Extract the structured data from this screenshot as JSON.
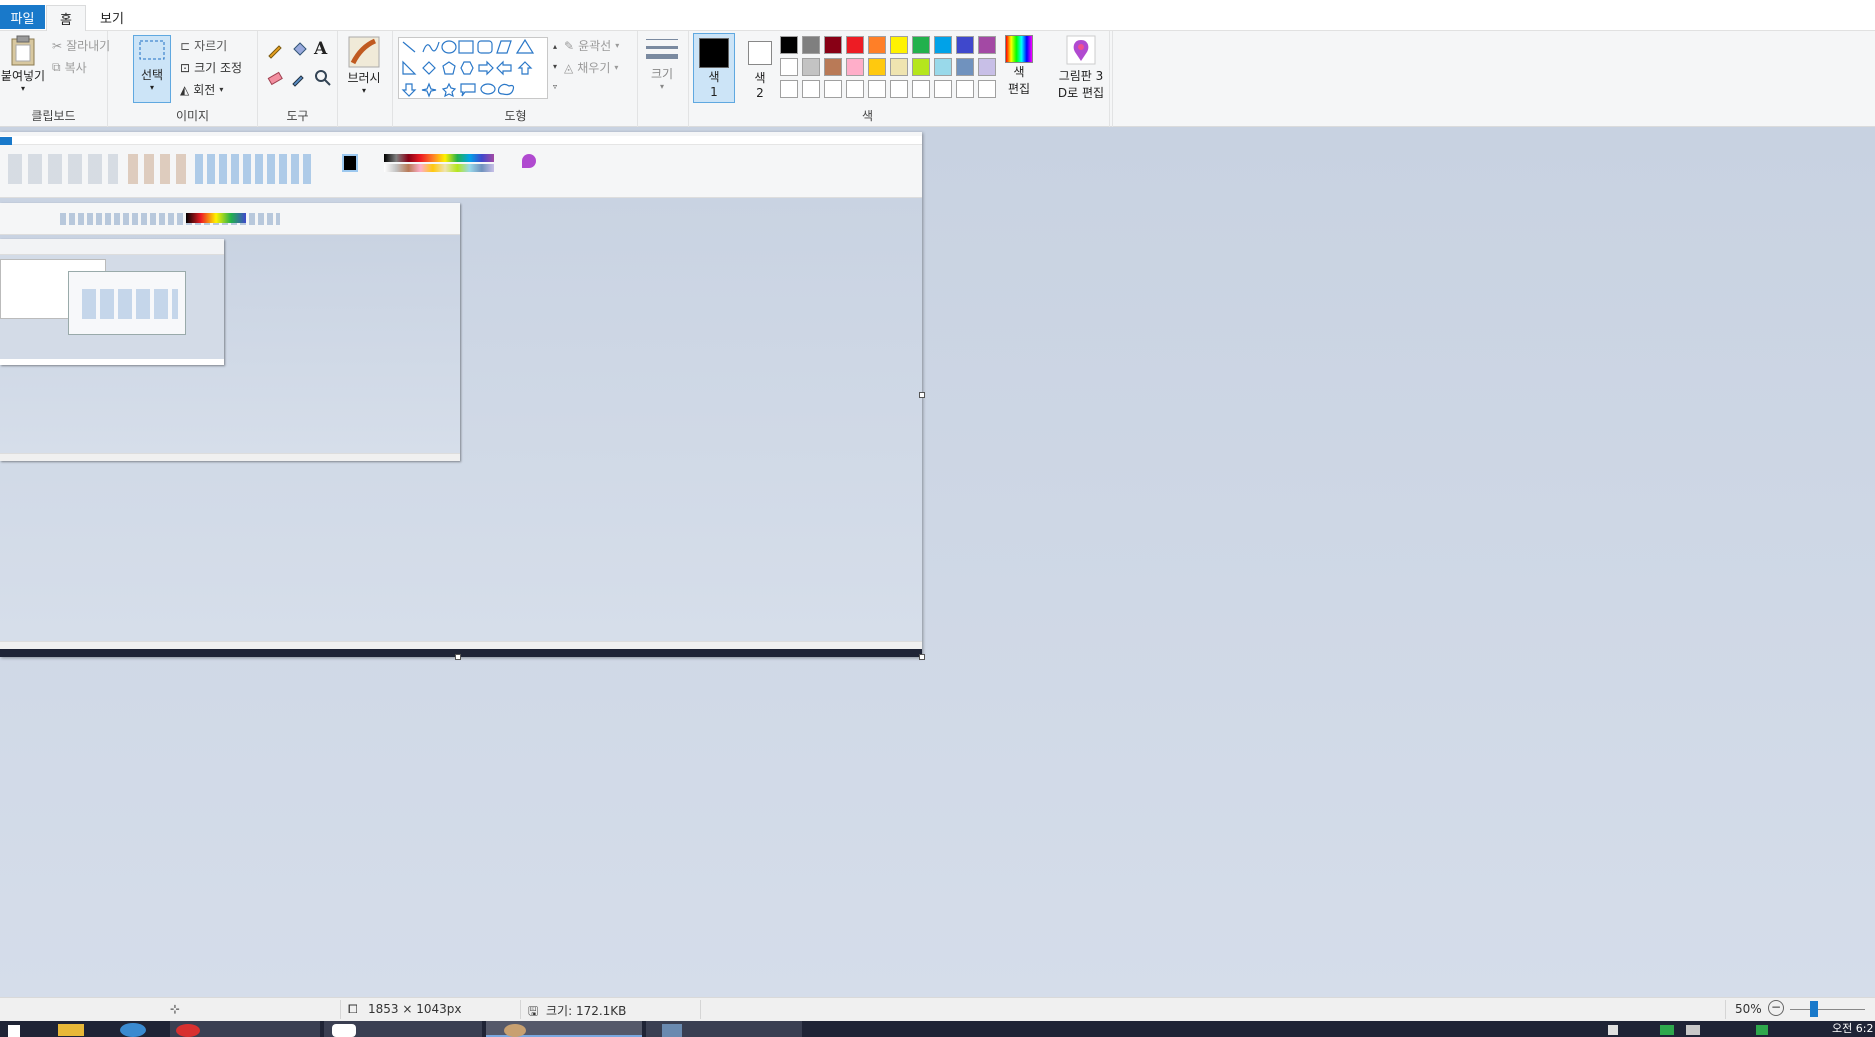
{
  "tabs": {
    "file": "파일",
    "home": "홈",
    "view": "보기"
  },
  "clipboard": {
    "paste": "붙여넣기",
    "cut": "잘라내기",
    "copy": "복사",
    "label": "클립보드"
  },
  "image_group": {
    "select": "선택",
    "crop": "자르기",
    "resize": "크기 조정",
    "rotate": "회전",
    "label": "이미지"
  },
  "tools": {
    "label": "도구"
  },
  "brushes": {
    "label": "브러시"
  },
  "shapes": {
    "outline": "윤곽선",
    "fill": "채우기",
    "label": "도형"
  },
  "size": {
    "label": "크기"
  },
  "colors": {
    "color1_line1": "색",
    "color1_line2": "1",
    "color2_line1": "색",
    "color2_line2": "2",
    "edit_line1": "색",
    "edit_line2": "편집",
    "label": "색",
    "palette_row1": [
      "#000000",
      "#7f7f7f",
      "#880015",
      "#ed1c24",
      "#ff7f27",
      "#fff200",
      "#22b14c",
      "#00a2e8",
      "#3f48cc",
      "#a349a4"
    ],
    "palette_row2": [
      "#ffffff",
      "#c3c3c3",
      "#b97a57",
      "#ffaec9",
      "#ffc90e",
      "#efe4b0",
      "#b5e61d",
      "#99d9ea",
      "#7092be",
      "#c8bfe7"
    ],
    "palette_row3": [
      "#ffffff",
      "#ffffff",
      "#ffffff",
      "#ffffff",
      "#ffffff",
      "#ffffff",
      "#ffffff",
      "#ffffff",
      "#ffffff",
      "#ffffff"
    ]
  },
  "paint3d": {
    "line1": "그림판 3",
    "line2": "D로 편집"
  },
  "status": {
    "dimensions": "1853 × 1043px",
    "size": "크기: 172.1KB",
    "zoom": "50%"
  },
  "clock": "오전 6:2"
}
